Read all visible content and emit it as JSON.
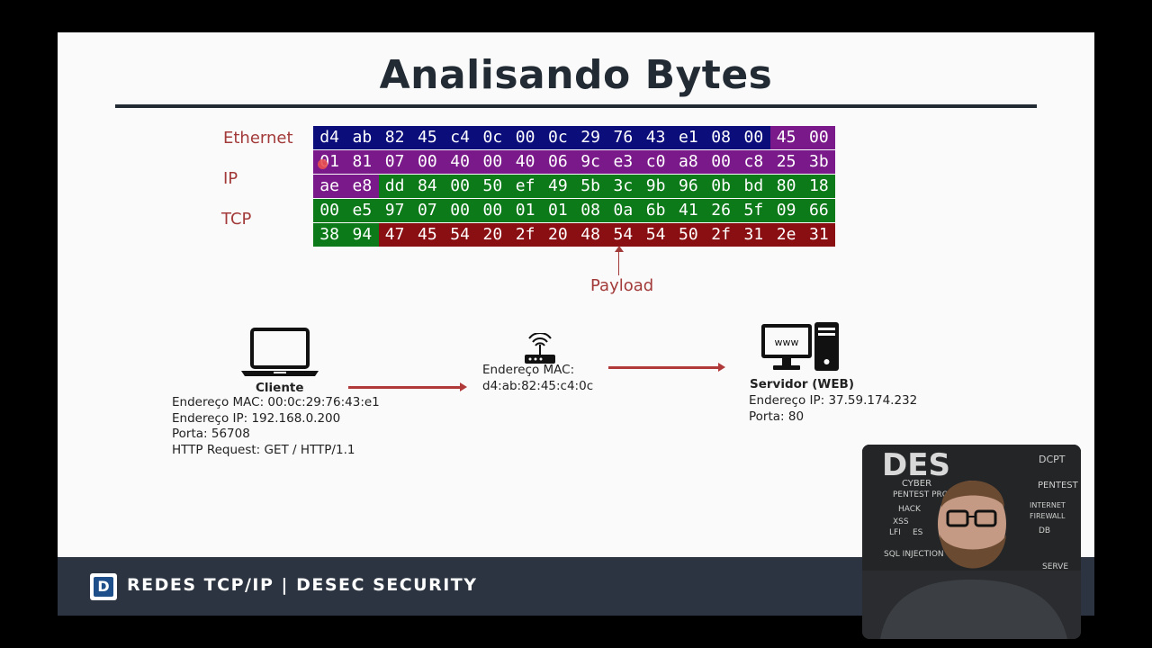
{
  "slide": {
    "title": "Analisando Bytes"
  },
  "layers": {
    "ethernet": "Ethernet",
    "ip": "IP",
    "tcp": "TCP"
  },
  "hex_rows": [
    [
      {
        "b": "d4",
        "l": "eth"
      },
      {
        "b": "ab",
        "l": "eth"
      },
      {
        "b": "82",
        "l": "eth"
      },
      {
        "b": "45",
        "l": "eth"
      },
      {
        "b": "c4",
        "l": "eth"
      },
      {
        "b": "0c",
        "l": "eth"
      },
      {
        "b": "00",
        "l": "eth"
      },
      {
        "b": "0c",
        "l": "eth"
      },
      {
        "b": "29",
        "l": "eth"
      },
      {
        "b": "76",
        "l": "eth"
      },
      {
        "b": "43",
        "l": "eth"
      },
      {
        "b": "e1",
        "l": "eth"
      },
      {
        "b": "08",
        "l": "eth"
      },
      {
        "b": "00",
        "l": "eth"
      },
      {
        "b": "45",
        "l": "ip"
      },
      {
        "b": "00",
        "l": "ip"
      }
    ],
    [
      {
        "b": "01",
        "l": "ip"
      },
      {
        "b": "81",
        "l": "ip"
      },
      {
        "b": "07",
        "l": "ip"
      },
      {
        "b": "00",
        "l": "ip"
      },
      {
        "b": "40",
        "l": "ip"
      },
      {
        "b": "00",
        "l": "ip"
      },
      {
        "b": "40",
        "l": "ip"
      },
      {
        "b": "06",
        "l": "ip"
      },
      {
        "b": "9c",
        "l": "ip"
      },
      {
        "b": "e3",
        "l": "ip"
      },
      {
        "b": "c0",
        "l": "ip"
      },
      {
        "b": "a8",
        "l": "ip"
      },
      {
        "b": "00",
        "l": "ip"
      },
      {
        "b": "c8",
        "l": "ip"
      },
      {
        "b": "25",
        "l": "ip"
      },
      {
        "b": "3b",
        "l": "ip"
      }
    ],
    [
      {
        "b": "ae",
        "l": "ip"
      },
      {
        "b": "e8",
        "l": "ip"
      },
      {
        "b": "dd",
        "l": "tcp"
      },
      {
        "b": "84",
        "l": "tcp"
      },
      {
        "b": "00",
        "l": "tcp"
      },
      {
        "b": "50",
        "l": "tcp"
      },
      {
        "b": "ef",
        "l": "tcp"
      },
      {
        "b": "49",
        "l": "tcp"
      },
      {
        "b": "5b",
        "l": "tcp"
      },
      {
        "b": "3c",
        "l": "tcp"
      },
      {
        "b": "9b",
        "l": "tcp"
      },
      {
        "b": "96",
        "l": "tcp"
      },
      {
        "b": "0b",
        "l": "tcp"
      },
      {
        "b": "bd",
        "l": "tcp"
      },
      {
        "b": "80",
        "l": "tcp"
      },
      {
        "b": "18",
        "l": "tcp"
      }
    ],
    [
      {
        "b": "00",
        "l": "tcp"
      },
      {
        "b": "e5",
        "l": "tcp"
      },
      {
        "b": "97",
        "l": "tcp"
      },
      {
        "b": "07",
        "l": "tcp"
      },
      {
        "b": "00",
        "l": "tcp"
      },
      {
        "b": "00",
        "l": "tcp"
      },
      {
        "b": "01",
        "l": "tcp"
      },
      {
        "b": "01",
        "l": "tcp"
      },
      {
        "b": "08",
        "l": "tcp"
      },
      {
        "b": "0a",
        "l": "tcp"
      },
      {
        "b": "6b",
        "l": "tcp"
      },
      {
        "b": "41",
        "l": "tcp"
      },
      {
        "b": "26",
        "l": "tcp"
      },
      {
        "b": "5f",
        "l": "tcp"
      },
      {
        "b": "09",
        "l": "tcp"
      },
      {
        "b": "66",
        "l": "tcp"
      }
    ],
    [
      {
        "b": "38",
        "l": "tcp"
      },
      {
        "b": "94",
        "l": "tcp"
      },
      {
        "b": "47",
        "l": "pay"
      },
      {
        "b": "45",
        "l": "pay"
      },
      {
        "b": "54",
        "l": "pay"
      },
      {
        "b": "20",
        "l": "pay"
      },
      {
        "b": "2f",
        "l": "pay"
      },
      {
        "b": "20",
        "l": "pay"
      },
      {
        "b": "48",
        "l": "pay"
      },
      {
        "b": "54",
        "l": "pay"
      },
      {
        "b": "54",
        "l": "pay"
      },
      {
        "b": "50",
        "l": "pay"
      },
      {
        "b": "2f",
        "l": "pay"
      },
      {
        "b": "31",
        "l": "pay"
      },
      {
        "b": "2e",
        "l": "pay"
      },
      {
        "b": "31",
        "l": "pay"
      }
    ]
  ],
  "payload_label": "Payload",
  "client": {
    "name": "Cliente",
    "mac": "Endereço MAC: 00:0c:29:76:43:e1",
    "ip": "Endereço IP: 192.168.0.200",
    "port": "Porta: 56708",
    "request": "HTTP Request: GET / HTTP/1.1"
  },
  "router": {
    "mac_label": "Endereço MAC:",
    "mac": "d4:ab:82:45:c4:0c"
  },
  "server": {
    "name": "Servidor (WEB)",
    "ip": "Endereço IP: 37.59.174.232",
    "port": "Porta: 80",
    "screen_text": "www"
  },
  "footer": {
    "logo_letter": "D",
    "text": "REDES TCP/IP | DESEC SECURITY"
  },
  "webcam": {
    "board_text": "DES",
    "board_notes": [
      "DCPT",
      "CYBER",
      "PENTEST PRO",
      "PENTEST",
      "HACK",
      "INTERNET",
      "FIREWALL",
      "XSS",
      "LFI",
      "ES",
      "SQL INJECTION",
      "DB",
      "SERVE"
    ]
  },
  "colors": {
    "ethernet": "#0a0d7a",
    "ip": "#7a1a8a",
    "tcp": "#0d7a1a",
    "payload": "#8a0f12",
    "accent": "#a33a3a",
    "footer_bg": "#2b3440"
  }
}
